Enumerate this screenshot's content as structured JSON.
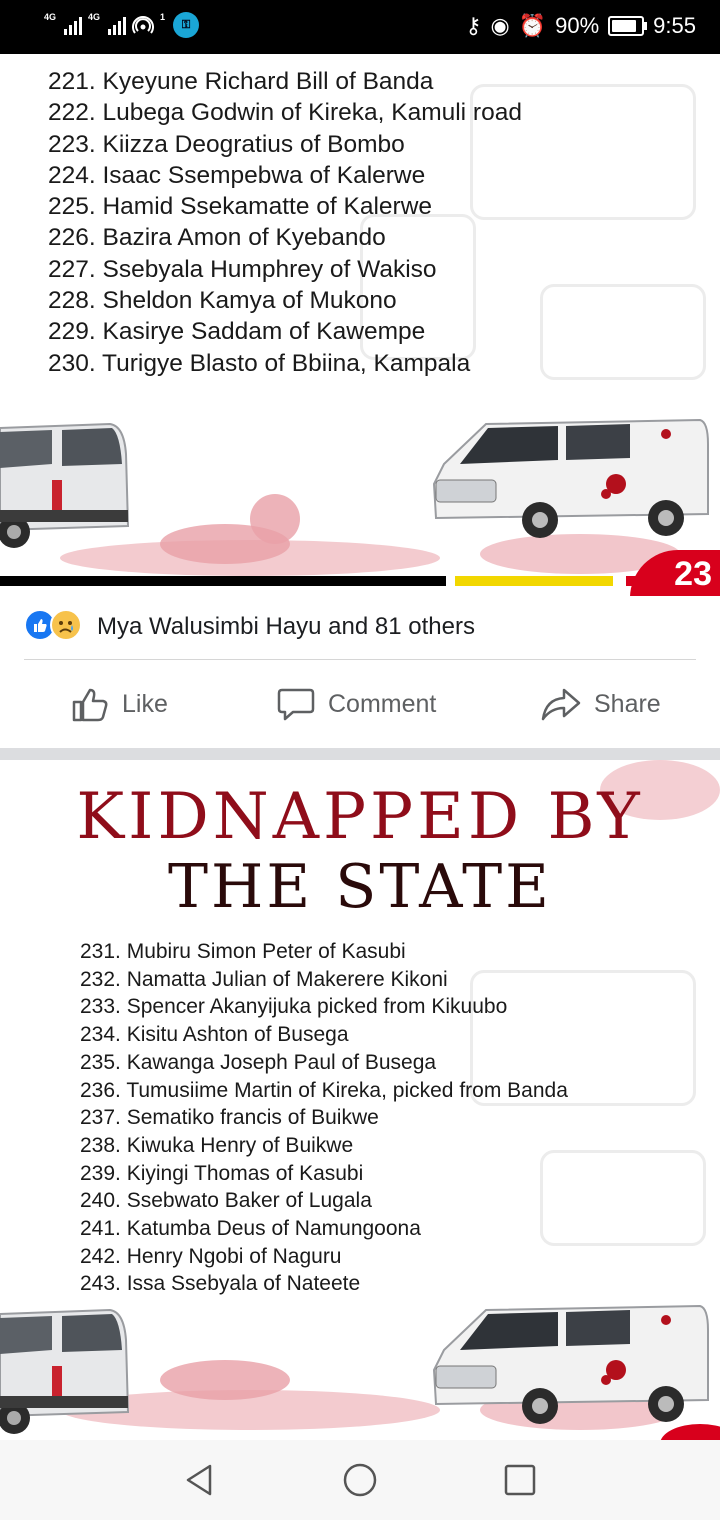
{
  "status_bar": {
    "network1": "4G",
    "network2": "4G",
    "hotspot_count": "1",
    "battery": "90%",
    "time": "9:55",
    "battery_level": 0.9
  },
  "post1": {
    "list": [
      "221. Kyeyune Richard Bill of Banda",
      "222. Lubega Godwin of Kireka, Kamuli road",
      "223. Kiizza Deogratius of Bombo",
      "224. Isaac Ssempebwa of Kalerwe",
      "225. Hamid Ssekamatte of Kalerwe",
      "226. Bazira Amon of Kyebando",
      "227. Ssebyala Humphrey of Wakiso",
      "228. Sheldon Kamya of Mukono",
      "229. Kasirye Saddam of Kawempe",
      "230. Turigye Blasto of Bbiina, Kampala"
    ],
    "page_number": "23"
  },
  "reactions": {
    "text": "Mya Walusimbi Hayu and 81 others",
    "icons": [
      "like-icon",
      "sad-icon"
    ]
  },
  "actions": {
    "like": "Like",
    "comment": "Comment",
    "share": "Share"
  },
  "post2": {
    "headline1": "KIDNAPPED BY",
    "headline2": "THE STATE",
    "list": [
      "231. Mubiru Simon Peter of Kasubi",
      "232. Namatta Julian of Makerere Kikoni",
      "233. Spencer Akanyijuka picked from Kikuubo",
      "234. Kisitu Ashton of Busega",
      "235. Kawanga Joseph Paul of Busega",
      "236. Tumusiime Martin of Kireka, picked from Banda",
      "237. Sematiko francis of Buikwe",
      "238. Kiwuka Henry of Buikwe",
      "239. Kiyingi Thomas of Kasubi",
      "240. Ssebwato Baker of Lugala",
      "241. Katumba Deus of Namungoona",
      "242. Henry Ngobi of Naguru",
      "243. Issa Ssebyala of Nateete"
    ]
  },
  "colors": {
    "accent_blood": "#8f0d1a",
    "fb_blue": "#1877f2",
    "flag_black": "#000000",
    "flag_yellow": "#f2d700",
    "flag_red": "#d8001c"
  }
}
